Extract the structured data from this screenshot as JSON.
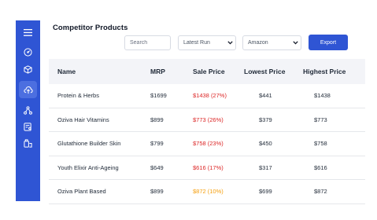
{
  "sidebar": {
    "color": "#2f55d4",
    "items": [
      {
        "icon": "hamburger-menu-icon"
      },
      {
        "icon": "speedometer-icon"
      },
      {
        "icon": "cube-icon"
      },
      {
        "icon": "cloud-upload-icon",
        "active": true
      },
      {
        "icon": "hierarchy-icon"
      },
      {
        "icon": "user-list-icon"
      },
      {
        "icon": "box-tag-icon"
      }
    ]
  },
  "page": {
    "title": "Competitor Products"
  },
  "toolbar": {
    "search_placeholder": "Search",
    "run_select": "Latest Run",
    "marketplace_select": "Amazon",
    "export_label": "Export",
    "accent": "#2f55d4"
  },
  "table": {
    "headers": {
      "name": "Name",
      "mrp": "MRP",
      "sale": "Sale Price",
      "low": "Lowest Price",
      "high": "Highest Price"
    },
    "rows": [
      {
        "name": "Protein & Herbs",
        "mrp": "$1699",
        "sale": "$1438 (27%)",
        "sale_color": "red",
        "low": "$441",
        "high": "$1438"
      },
      {
        "name": "Oziva Hair Vitamins",
        "mrp": "$899",
        "sale": "$773 (26%)",
        "sale_color": "red",
        "low": "$379",
        "high": "$773"
      },
      {
        "name": "Glutathione Builder Skin",
        "mrp": "$799",
        "sale": "$758 (23%)",
        "sale_color": "red",
        "low": "$450",
        "high": "$758"
      },
      {
        "name": "Youth Elixir Anti-Ageing",
        "mrp": "$649",
        "sale": "$616 (17%)",
        "sale_color": "red",
        "low": "$317",
        "high": "$616"
      },
      {
        "name": "Oziva Plant Based",
        "mrp": "$899",
        "sale": "$872 (10%)",
        "sale_color": "orange",
        "low": "$699",
        "high": "$872"
      }
    ]
  }
}
